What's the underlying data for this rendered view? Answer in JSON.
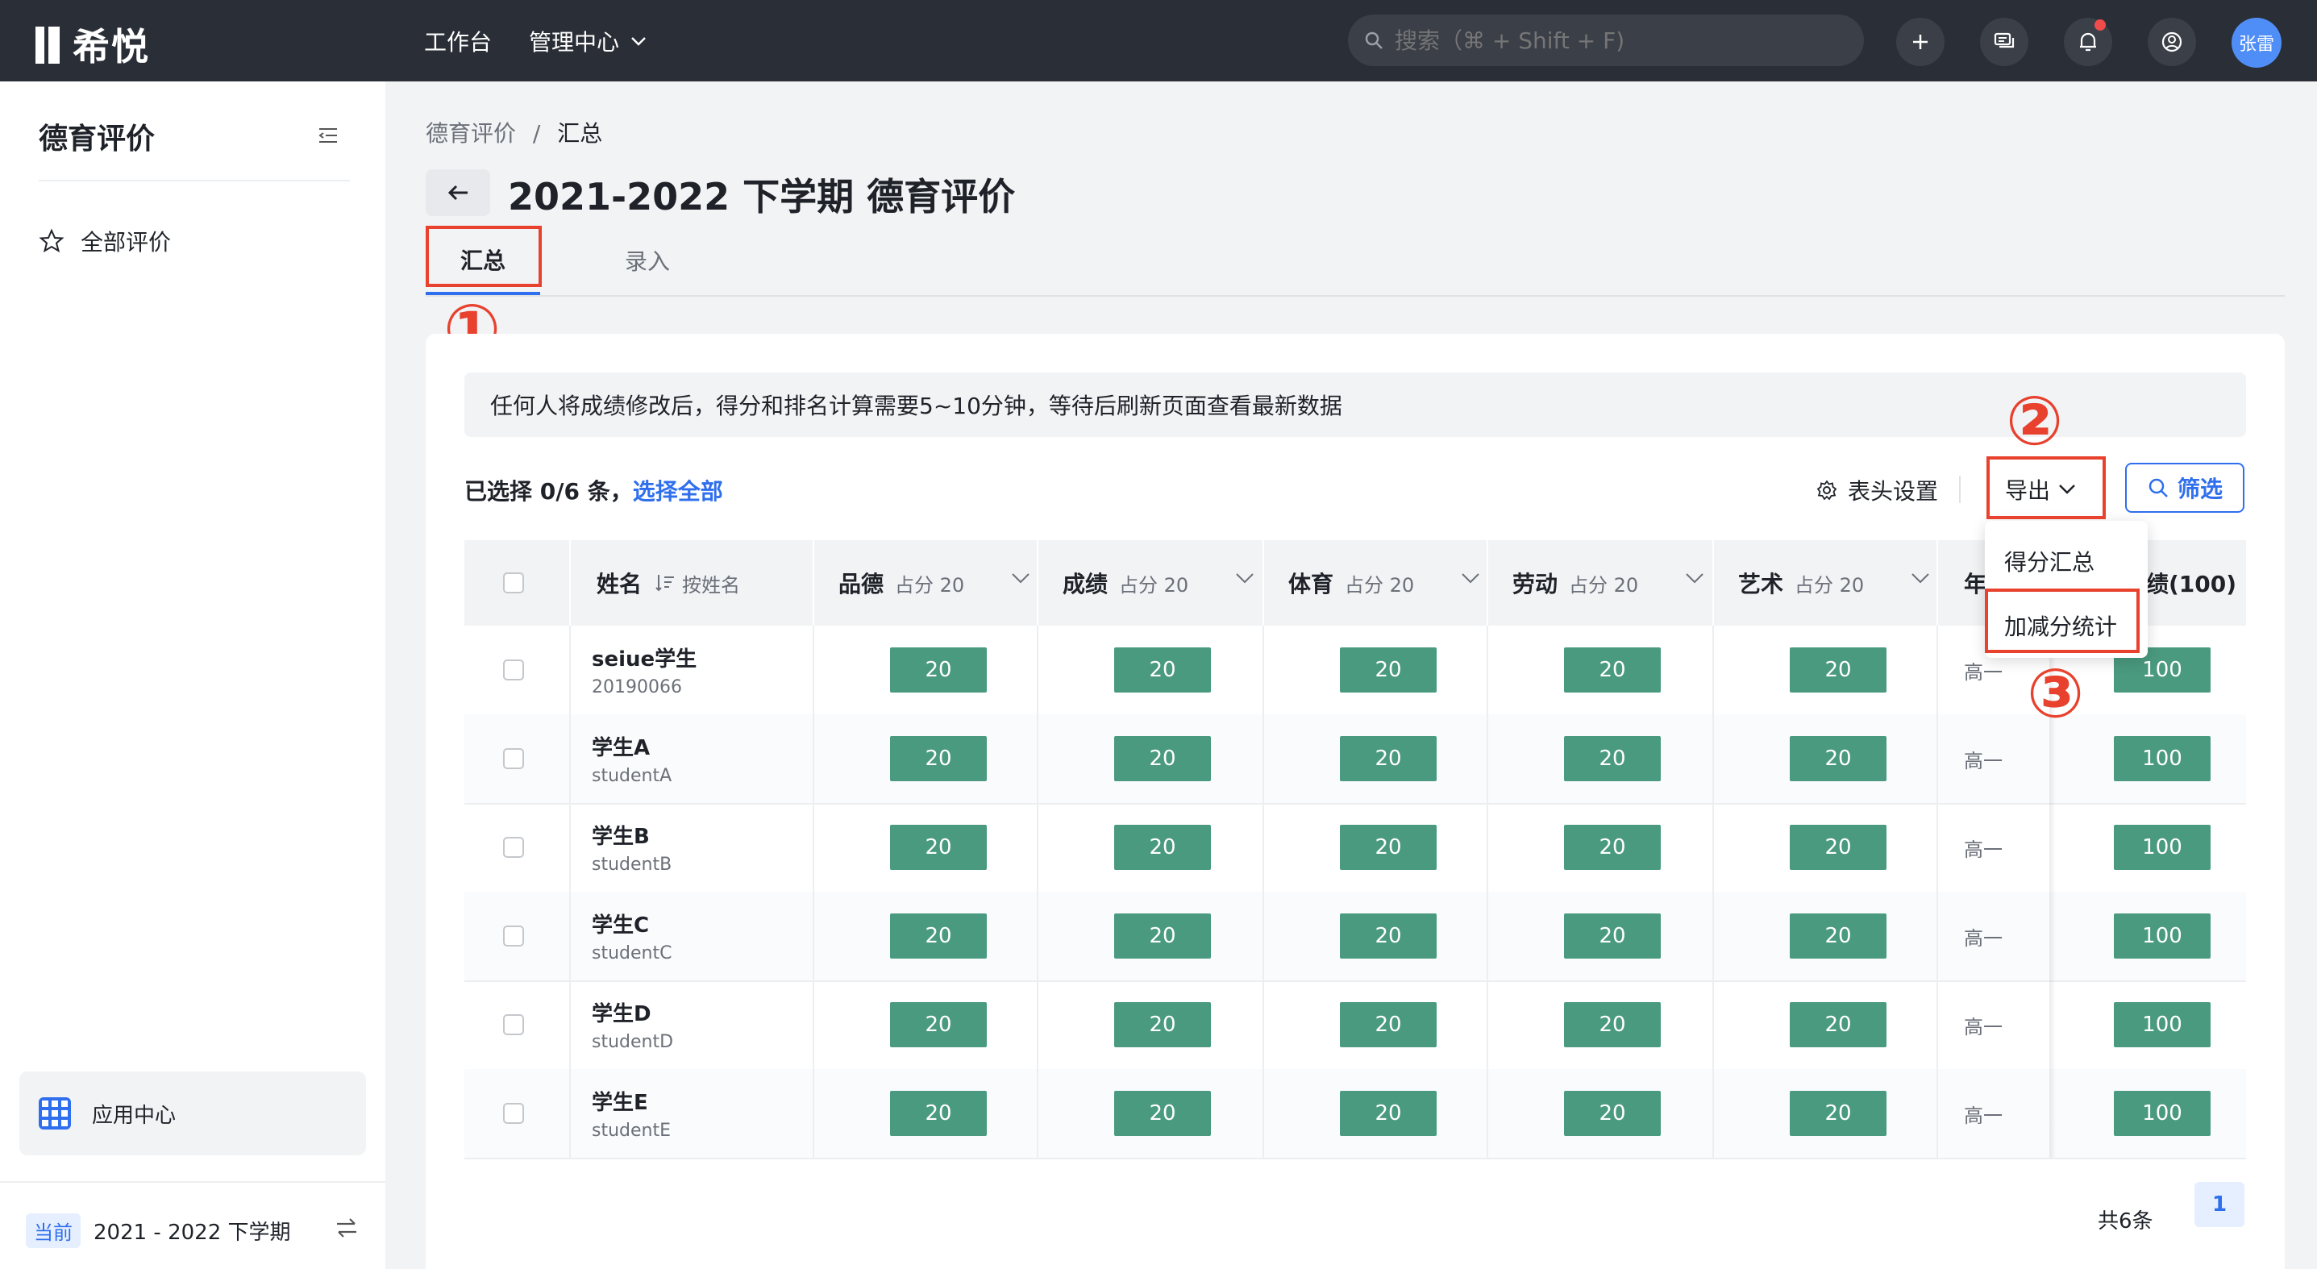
{
  "app": {
    "logo_text": "希悦"
  },
  "topnav": {
    "workbench": "工作台",
    "admin_center": "管理中心"
  },
  "search": {
    "placeholder": "搜索（⌘ + Shift + F)"
  },
  "user": {
    "name": "张雷"
  },
  "sidebar": {
    "title": "德育评价",
    "items": [
      {
        "label": "全部评价"
      }
    ],
    "app_center": "应用中心",
    "term_tag": "当前",
    "term_label": "2021 - 2022 下学期"
  },
  "breadcrumb": {
    "parent": "德育评价",
    "separator": "/",
    "current": "汇总"
  },
  "page": {
    "title": "2021-2022 下学期 德育评价"
  },
  "tabs": [
    {
      "label": "汇总"
    },
    {
      "label": "录入"
    }
  ],
  "annotations": {
    "one": "①",
    "two": "②",
    "three": "③"
  },
  "notice": "任何人将成绩修改后，得分和排名计算需要5~10分钟，等待后刷新页面查看最新数据",
  "selection": {
    "text": "已选择 0/6 条，",
    "select_all": "选择全部"
  },
  "toolbar": {
    "header_settings": "表头设置",
    "export": "导出",
    "filter": "筛选"
  },
  "export_menu": [
    "得分汇总",
    "加减分统计"
  ],
  "table": {
    "columns": [
      {
        "label": "姓名",
        "sub": "按姓名"
      },
      {
        "label": "品德",
        "sub": "占分 20"
      },
      {
        "label": "成绩",
        "sub": "占分 20"
      },
      {
        "label": "体育",
        "sub": "占分 20"
      },
      {
        "label": "劳动",
        "sub": "占分 20"
      },
      {
        "label": "艺术",
        "sub": "占分 20"
      },
      {
        "label": "年"
      },
      {
        "label": "绩(100)"
      }
    ],
    "rows": [
      {
        "name": "seiue学生",
        "id": "20190066",
        "scores": [
          "20",
          "20",
          "20",
          "20",
          "20"
        ],
        "grade": "高一",
        "total": "100"
      },
      {
        "name": "学生A",
        "id": "studentA",
        "scores": [
          "20",
          "20",
          "20",
          "20",
          "20"
        ],
        "grade": "高一",
        "total": "100"
      },
      {
        "name": "学生B",
        "id": "studentB",
        "scores": [
          "20",
          "20",
          "20",
          "20",
          "20"
        ],
        "grade": "高一",
        "total": "100"
      },
      {
        "name": "学生C",
        "id": "studentC",
        "scores": [
          "20",
          "20",
          "20",
          "20",
          "20"
        ],
        "grade": "高一",
        "total": "100"
      },
      {
        "name": "学生D",
        "id": "studentD",
        "scores": [
          "20",
          "20",
          "20",
          "20",
          "20"
        ],
        "grade": "高一",
        "total": "100"
      },
      {
        "name": "学生E",
        "id": "studentE",
        "scores": [
          "20",
          "20",
          "20",
          "20",
          "20"
        ],
        "grade": "高一",
        "total": "100"
      }
    ]
  },
  "pagination": {
    "total": "共6条",
    "page": "1"
  },
  "colors": {
    "accent": "#2f6fed",
    "score_bg": "#4a9a7f",
    "annotation": "#e8412d",
    "topbar": "#2a2e36"
  }
}
